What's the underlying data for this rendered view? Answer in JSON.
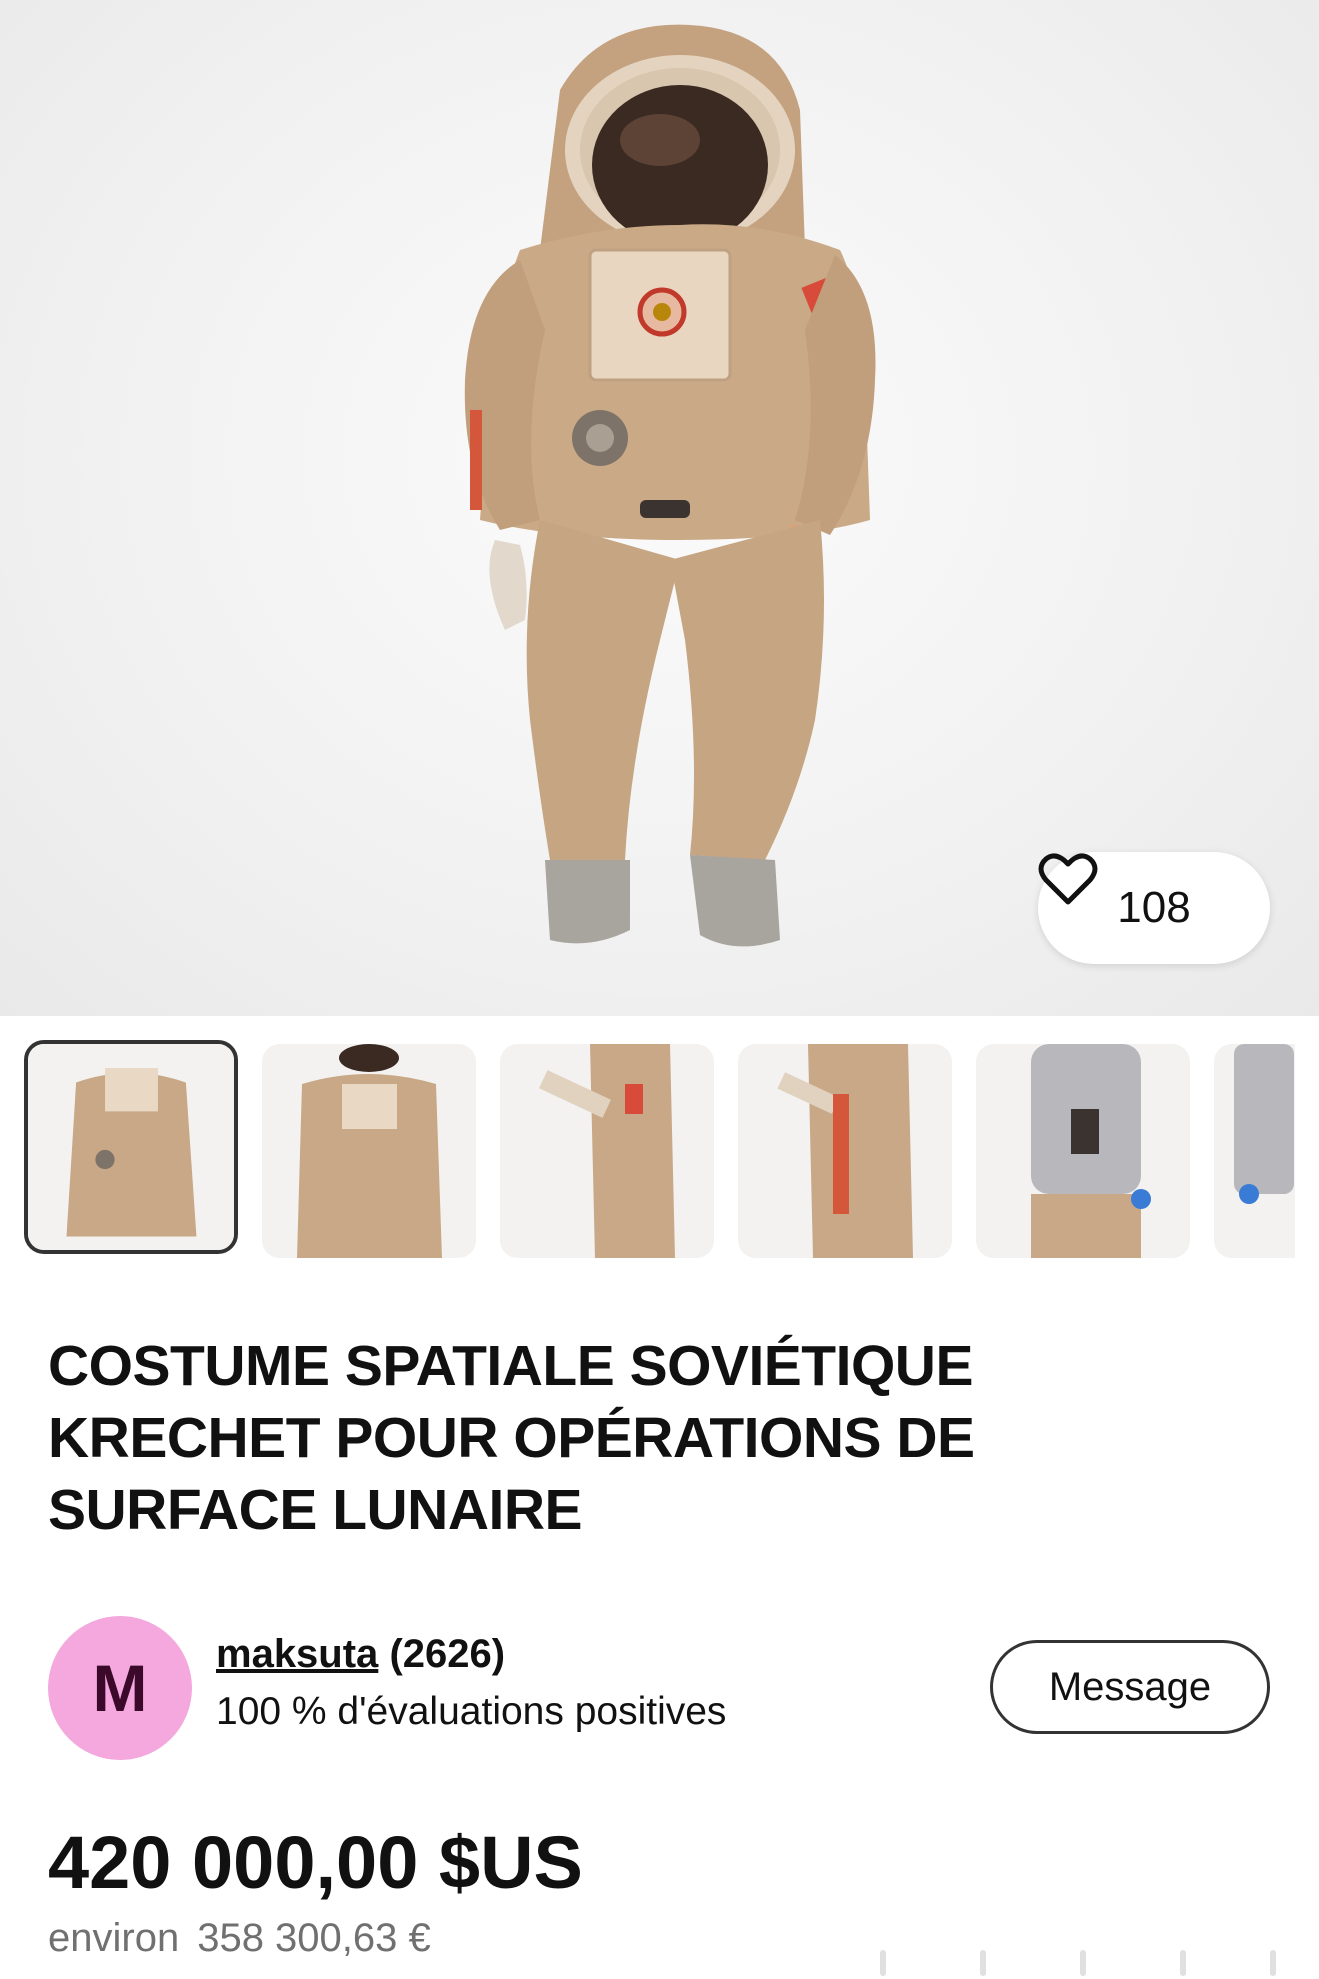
{
  "listing": {
    "likes": "108",
    "title": "COSTUME SPATIALE SOVIÉTIQUE KRECHET POUR OPÉRATIONS DE SURFACE LUNAIRE",
    "price": "420 000,00 $US",
    "approx_label": "environ",
    "approx_value": "358 300,63 €"
  },
  "seller": {
    "avatar_letter": "M",
    "name": "maksuta",
    "feedback_count": "(2626)",
    "feedback": "100 % d'évaluations positives",
    "message_label": "Message"
  },
  "gallery": {
    "selected_index": 0,
    "thumbnail_count": 6
  },
  "icons": {
    "like": "heart-icon"
  },
  "colors": {
    "avatar_bg": "#f4a8dd",
    "suit": "#c9a987"
  }
}
